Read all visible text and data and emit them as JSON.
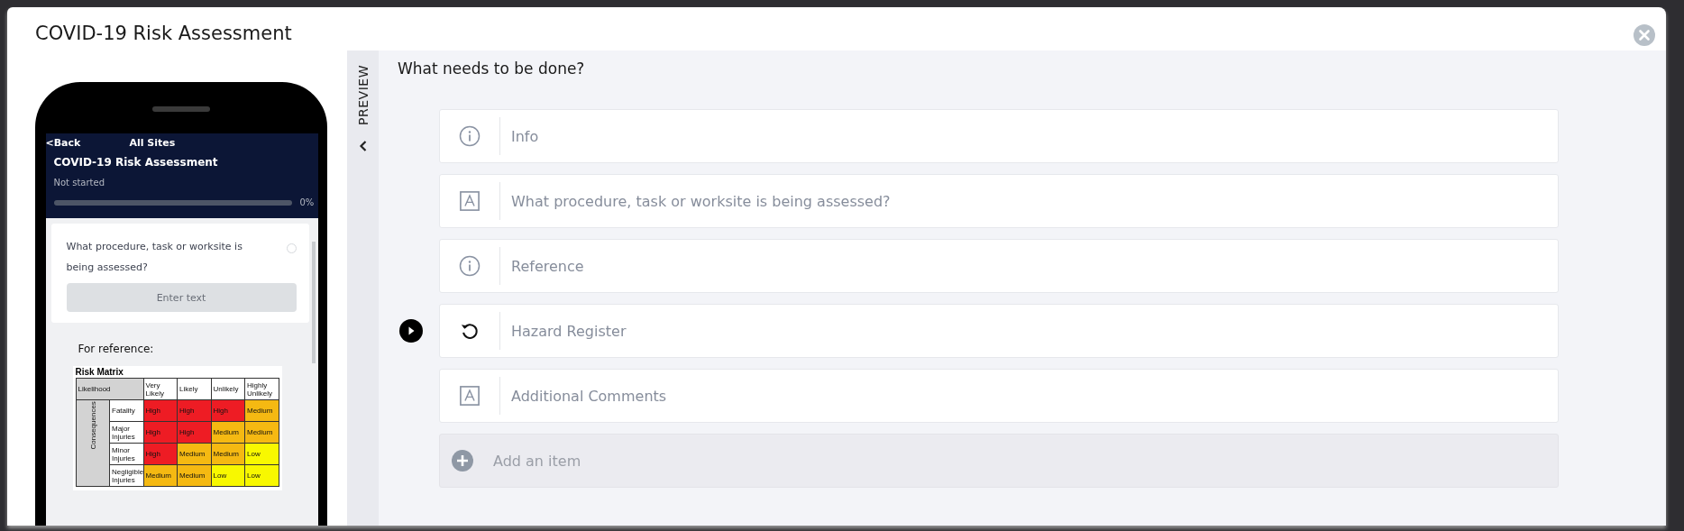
{
  "modal": {
    "title": "COVID-19 Risk Assessment"
  },
  "phone": {
    "back": "<Back",
    "site": "All Sites",
    "title": "COVID-19 Risk Assessment",
    "status": "Not started",
    "progress": {
      "level": 0,
      "reading": "0%"
    },
    "question": {
      "text": "What procedure, task or worksite is being assessed?",
      "answered": false,
      "placeholder": "Enter text"
    },
    "reference_label": "For reference:",
    "matrix": {
      "title": "Risk Matrix",
      "corner": "Likelihood",
      "side": "Consequences",
      "columns": [
        "Very Likely",
        "Likely",
        "Unlikely",
        "Highly Unlikely"
      ],
      "rows": [
        {
          "label": "Fatality",
          "cells": [
            {
              "text": "High",
              "color": "#ee1c24"
            },
            {
              "text": "High",
              "color": "#ee1c24"
            },
            {
              "text": "High",
              "color": "#ee1c24"
            },
            {
              "text": "Medium",
              "color": "#f5b912"
            }
          ]
        },
        {
          "label": "Major Injuries",
          "cells": [
            {
              "text": "High",
              "color": "#ee1c24"
            },
            {
              "text": "High",
              "color": "#ee1c24"
            },
            {
              "text": "Medium",
              "color": "#f5b912"
            },
            {
              "text": "Medium",
              "color": "#f5b912"
            }
          ]
        },
        {
          "label": "Minor Injuries",
          "cells": [
            {
              "text": "High",
              "color": "#ee1c24"
            },
            {
              "text": "Medium",
              "color": "#f5b912"
            },
            {
              "text": "Medium",
              "color": "#f5b912"
            },
            {
              "text": "Low",
              "color": "#f8f800"
            }
          ]
        },
        {
          "label": "Negligible Injuries",
          "cells": [
            {
              "text": "Medium",
              "color": "#f5b912"
            },
            {
              "text": "Medium",
              "color": "#f5b912"
            },
            {
              "text": "Low",
              "color": "#f8f800"
            },
            {
              "text": "Low",
              "color": "#f8f800"
            }
          ]
        }
      ]
    }
  },
  "preview_tab": {
    "label": "PREVIEW"
  },
  "editor": {
    "heading": "What needs to be done?",
    "items": [
      {
        "kind": "info",
        "label": "Info",
        "current": false
      },
      {
        "kind": "text",
        "label": "What procedure, task or worksite is being assessed?",
        "current": false
      },
      {
        "kind": "info",
        "label": "Reference",
        "current": false
      },
      {
        "kind": "repeat",
        "label": "Hazard Register",
        "current": true
      },
      {
        "kind": "text",
        "label": "Additional Comments",
        "current": false
      }
    ],
    "add_item": "Add an item"
  }
}
